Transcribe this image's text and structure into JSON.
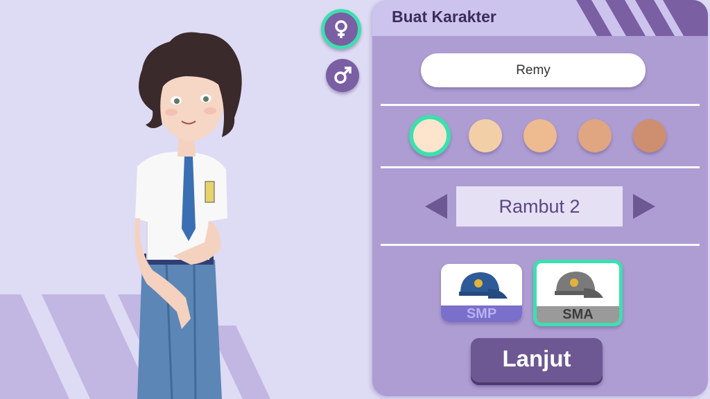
{
  "panel": {
    "title": "Buat Karakter"
  },
  "gender": {
    "female_icon": "female-symbol-icon",
    "male_icon": "male-symbol-icon",
    "selected": "female"
  },
  "name_input": {
    "value": "Remy"
  },
  "skin_tones": {
    "colors": [
      "#fde4cd",
      "#f3cfa8",
      "#eeba8f",
      "#e0a581",
      "#cd8f70"
    ],
    "selected_index": 0
  },
  "hair": {
    "label": "Rambut 2",
    "prev_icon": "triangle-left-icon",
    "next_icon": "triangle-right-icon"
  },
  "school_level": {
    "options": [
      {
        "label": "SMP",
        "cap_color": "#2e5a97",
        "label_bg": "#7a6fcb",
        "label_color": "#b9b1f3"
      },
      {
        "label": "SMA",
        "cap_color": "#7a7a7a",
        "label_bg": "#9a9a9a",
        "label_color": "#3d3d3d"
      }
    ],
    "selected": "SMA"
  },
  "next_button": {
    "label": "Lanjut"
  },
  "colors": {
    "accent_selected": "#3ce0ae",
    "panel": "#ad9dd2",
    "button": "#6d5893"
  }
}
